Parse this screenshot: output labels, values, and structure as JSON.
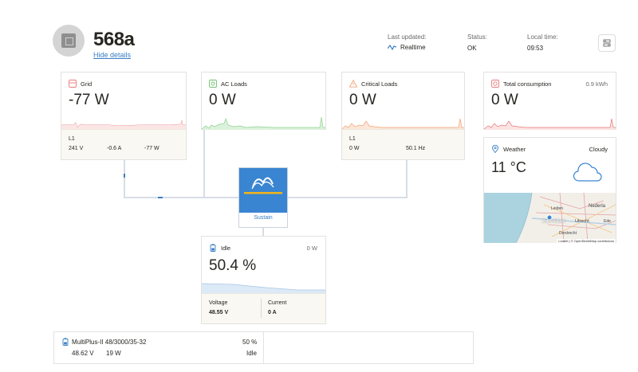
{
  "device": {
    "name": "568a",
    "hide_details": "Hide details"
  },
  "header": {
    "last_updated_label": "Last updated:",
    "last_updated_value": "Realtime",
    "status_label": "Status:",
    "status_value": "OK",
    "local_time_label": "Local time:",
    "local_time_value": "09:53"
  },
  "grid": {
    "title": "Grid",
    "power": "-77 W",
    "phase": "L1",
    "voltage": "241 V",
    "current": "-0.6 A",
    "phase_power": "-77 W"
  },
  "ac_loads": {
    "title": "AC Loads",
    "power": "0 W"
  },
  "critical_loads": {
    "title": "Critical Loads",
    "power": "0 W",
    "phase": "L1",
    "phase_power": "0 W",
    "frequency": "50.1 Hz"
  },
  "total_consumption": {
    "title": "Total consumption",
    "energy": "0.9 kWh",
    "power": "0 W"
  },
  "weather": {
    "title": "Weather",
    "condition": "Cloudy",
    "temperature": "11 °C",
    "map_labels": {
      "leiden": "Leiden",
      "nederland": "Nederla",
      "zuid_holland": "Zuid-Holland",
      "utrecht": "Utrecht",
      "ede": "Ede",
      "dordrecht": "Dordrecht",
      "attribution": "Leaflet | © OpenStreetMap contributors"
    }
  },
  "inverter": {
    "mode": "Sustain"
  },
  "battery": {
    "state": "Idle",
    "power": "0 W",
    "soc": "50.4 %",
    "voltage_label": "Voltage",
    "voltage_value": "48.55 V",
    "current_label": "Current",
    "current_value": "0 A"
  },
  "multiplus": {
    "name": "MultiPlus-II 48/3000/35-32",
    "percent": "50 %",
    "voltage": "48.62 V",
    "power": "19 W",
    "state": "Idle"
  },
  "colors": {
    "accent_blue": "#387dc5",
    "grid_red": "#e87a7a",
    "ac_green": "#8fd18f",
    "critical_orange": "#f0a37a",
    "battery_blue": "#c9dcf0"
  }
}
